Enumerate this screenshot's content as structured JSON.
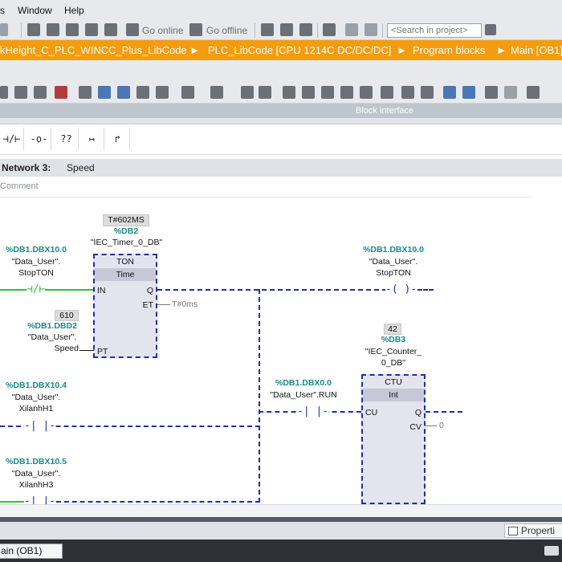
{
  "menu": [
    "s",
    "Window",
    "Help"
  ],
  "toolbar": {
    "go_online": "Go online",
    "go_offline": "Go offline",
    "search_placeholder": "<Search in project>"
  },
  "breadcrumb": [
    "kHeight_C_PLC_WINCC_Plus_LibCode",
    "PLC_LibCode [CPU 1214C DC/DC/DC]",
    "Program blocks",
    "Main [OB1]"
  ],
  "breadcrumb_separator": "►",
  "block_interface": "Block interface",
  "palette": [
    "⊣/⊢",
    "-o-",
    "??",
    "↦",
    "↱"
  ],
  "network": {
    "label": "Network 3:",
    "title": "Speed",
    "comment": "Comment"
  },
  "ladder": {
    "timer": {
      "preset_value": "T#602MS",
      "db_addr": "%DB2",
      "db_name": "\"IEC_Timer_0_DB\"",
      "type": "TON",
      "subtype": "Time",
      "pin_in": "IN",
      "pin_pt": "PT",
      "pin_q": "Q",
      "pin_et": "ET",
      "et_value": "T#0ms"
    },
    "contact_stopton_in": {
      "addr": "%DB1.DBX10.0",
      "db": "\"Data_User\".",
      "tag": "StopTON"
    },
    "speed_param": {
      "value": "610",
      "addr": "%DB1.DBD2",
      "db": "\"Data_User\".",
      "tag": "Speed"
    },
    "coil_stopton": {
      "addr": "%DB1.DBX10.0",
      "db": "\"Data_User\".",
      "tag": "StopTON"
    },
    "counter": {
      "value": "42",
      "db_addr": "%DB3",
      "db_name_1": "\"IEC_Counter_",
      "db_name_2": "0_DB\"",
      "type": "CTU",
      "subtype": "Int",
      "pin_cu": "CU",
      "pin_q": "Q",
      "pin_cv": "CV",
      "cv_value": "0"
    },
    "contact_run": {
      "addr": "%DB1.DBX0.0",
      "tag": "\"Data_User\".RUN"
    },
    "contact_xilanh1": {
      "addr": "%DB1.DBX10.4",
      "db": "\"Data_User\".",
      "tag": "XilanhH1"
    },
    "contact_xilanh3": {
      "addr": "%DB1.DBX10.5",
      "db": "\"Data_User\".",
      "tag": "XilanhH3"
    }
  },
  "properties_tab": "Properti",
  "taskbar_item": "ain (OB1)",
  "colors": {
    "breadcrumb_bg": "#f39c12",
    "wire_active": "#2ec52e",
    "wire_inactive": "#1f2fa8",
    "address_text": "#1a8a8a"
  }
}
